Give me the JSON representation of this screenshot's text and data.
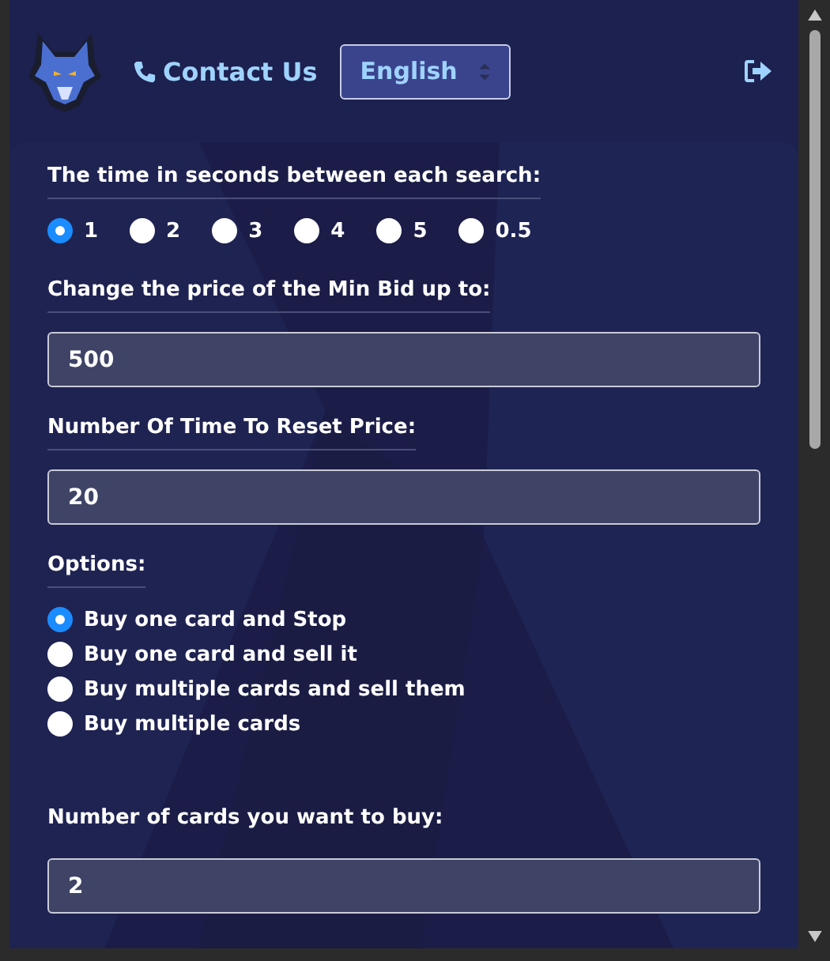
{
  "header": {
    "contact_label": "Contact Us",
    "language": {
      "value": "English"
    }
  },
  "sections": [
    {
      "kind": "radio-row",
      "label": "The time in seconds between each search:",
      "underlined": true,
      "options": [
        {
          "label": "1",
          "selected": true
        },
        {
          "label": "2",
          "selected": false
        },
        {
          "label": "3",
          "selected": false
        },
        {
          "label": "4",
          "selected": false
        },
        {
          "label": "5",
          "selected": false
        },
        {
          "label": "0.5",
          "selected": false
        }
      ]
    },
    {
      "kind": "input",
      "label": "Change the price of the Min Bid up to:",
      "underlined": true,
      "value": "500"
    },
    {
      "kind": "input",
      "label": "Number Of Time To Reset Price:",
      "underlined": true,
      "value": "20"
    },
    {
      "kind": "radio-list",
      "label": "Options:",
      "underlined": true,
      "options": [
        {
          "label": "Buy one card and Stop",
          "selected": true
        },
        {
          "label": "Buy one card and sell it",
          "selected": false
        },
        {
          "label": "Buy multiple cards and sell them",
          "selected": false
        },
        {
          "label": "Buy multiple cards",
          "selected": false
        }
      ]
    },
    {
      "kind": "input",
      "label": "Number of cards you want to buy:",
      "underlined": false,
      "value": "2"
    }
  ]
}
